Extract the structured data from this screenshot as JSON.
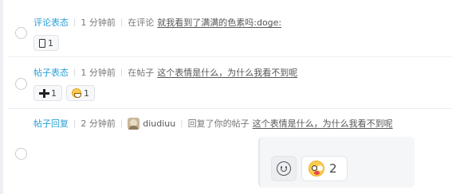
{
  "notifications": [
    {
      "type": "评论表态",
      "time": "1 分钟前",
      "prefix": "在评论",
      "target": "就我看到了满满的色素吗:doge:",
      "reactions": [
        {
          "icon": "box-icon",
          "count": "1"
        }
      ]
    },
    {
      "type": "帖子表态",
      "time": "1 分钟前",
      "prefix": "在帖子",
      "target": "这个表情是什么，为什么我看不到呢",
      "reactions": [
        {
          "icon": "plus-cross-icon",
          "count": "1"
        },
        {
          "icon": "grin-face-icon",
          "count": "1"
        }
      ]
    },
    {
      "type": "帖子回复",
      "time": "2 分钟前",
      "user": "diudiuu",
      "action": "回复了你的帖子",
      "target": "这个表情是什么，为什么我看不到呢",
      "reply_reactions": [
        {
          "icon": "smile-add-icon"
        },
        {
          "icon": "astonished-face-icon",
          "count": "2"
        }
      ]
    }
  ],
  "colors": {
    "type_link": "#2a9fd6",
    "divider": "#eceef1",
    "panel_bg": "#f5f6f8"
  }
}
